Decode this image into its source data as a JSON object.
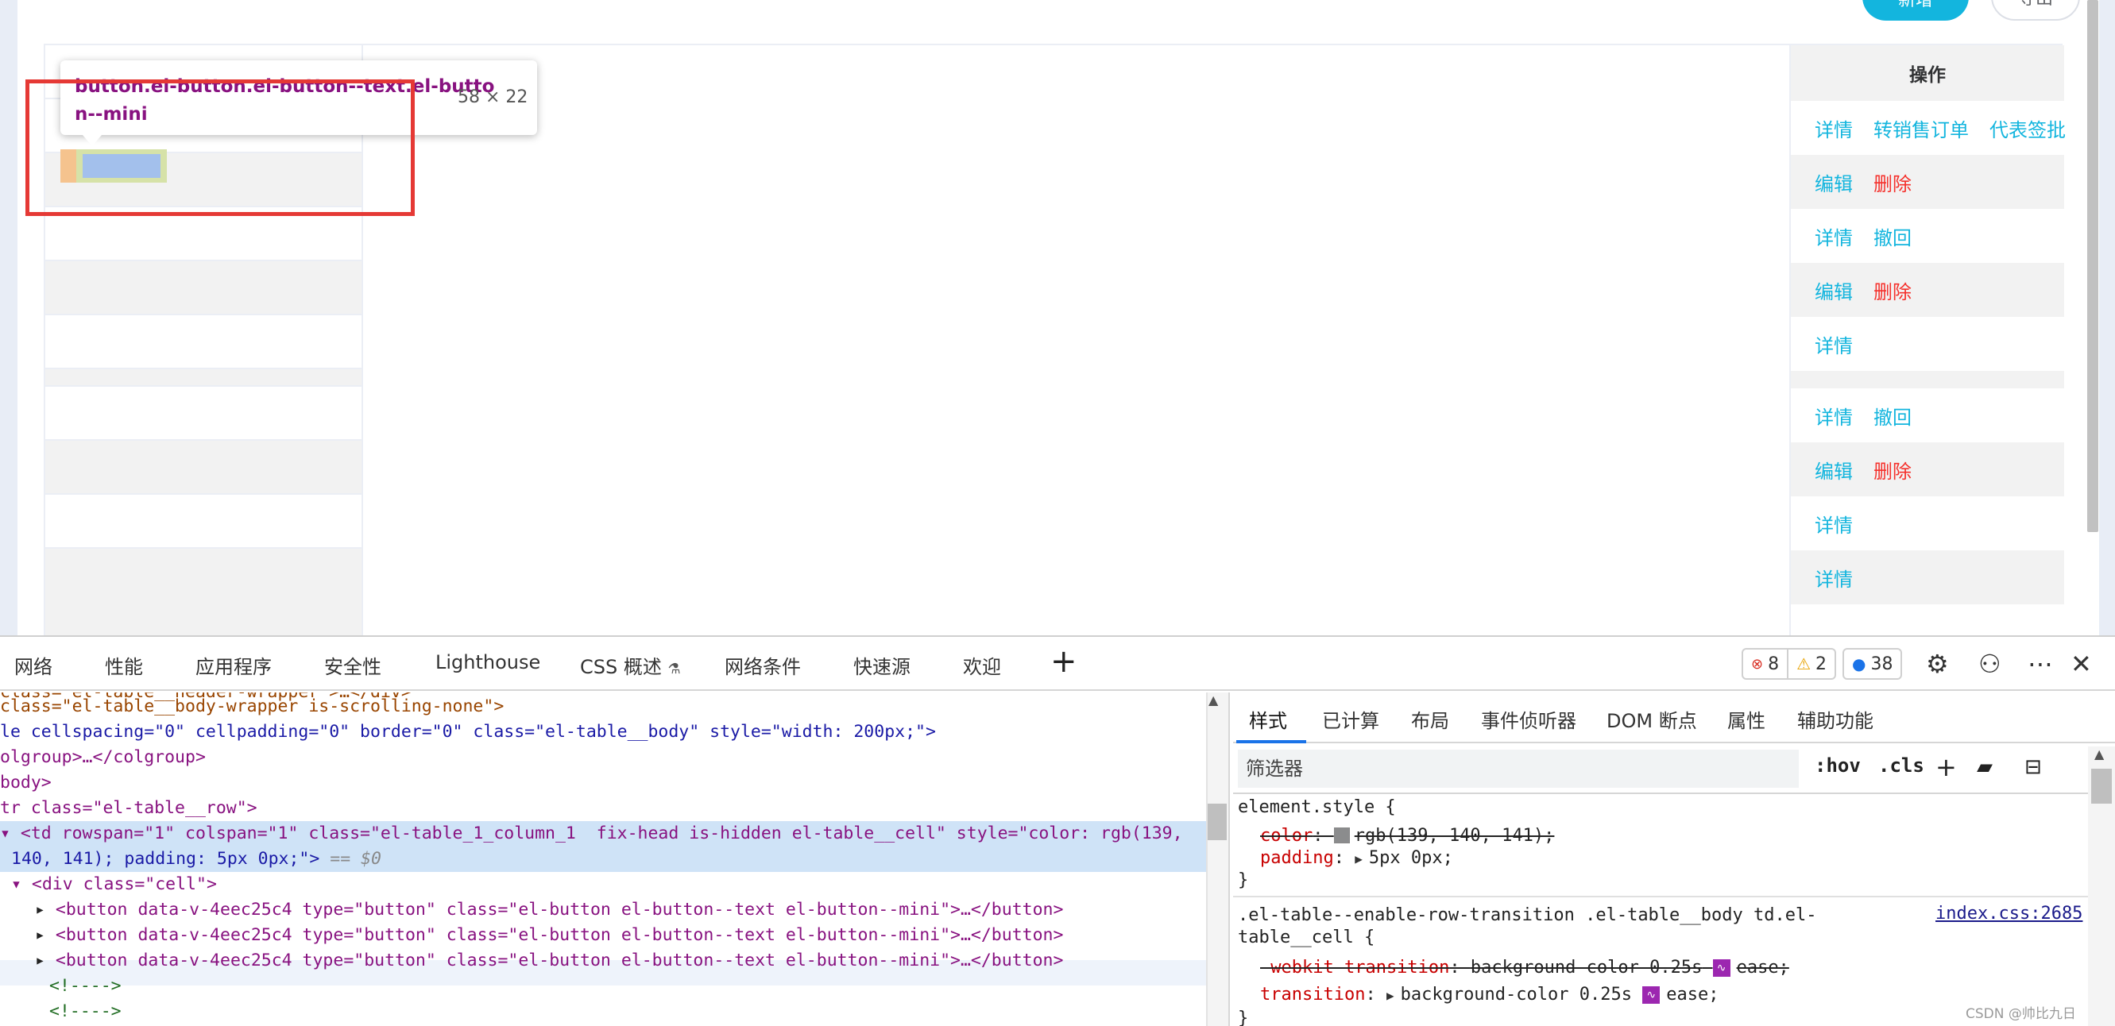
{
  "toolbar": {
    "add_label": "新增",
    "export_label": "导出"
  },
  "table": {
    "ops_header": "操作",
    "rows": [
      {
        "links": [
          "详情",
          "转销售订单",
          "代表签批"
        ],
        "delete": ""
      },
      {
        "links": [
          "编辑"
        ],
        "delete": "删除"
      },
      {
        "links": [
          "详情",
          "撤回"
        ],
        "delete": ""
      },
      {
        "links": [
          "编辑"
        ],
        "delete": "删除"
      },
      {
        "links": [
          "详情"
        ],
        "delete": ""
      },
      {
        "links": [
          "详情",
          "撤回"
        ],
        "delete": ""
      },
      {
        "links": [
          "编辑"
        ],
        "delete": "删除"
      },
      {
        "links": [
          "详情"
        ],
        "delete": ""
      },
      {
        "links": [
          "详情"
        ],
        "delete": ""
      }
    ]
  },
  "inspector_tooltip": {
    "selector": "button.el-button.el-button--text.el-button--mini",
    "size": "58 × 22"
  },
  "devtools": {
    "tabs": [
      "网络",
      "性能",
      "应用程序",
      "安全性",
      "Lighthouse",
      "CSS 概述",
      "网络条件",
      "快速源",
      "欢迎"
    ],
    "errors": "8",
    "warnings": "2",
    "messages": "38",
    "elements": {
      "line1": "class=\"el-table__header-wrapper\">…</div>",
      "line2": "class=\"el-table__body-wrapper is-scrolling-none\">",
      "line3": "le cellspacing=\"0\" cellpadding=\"0\" border=\"0\" class=\"el-table__body\" style=\"width: 200px;\">",
      "line4": "olgroup>…</colgroup>",
      "line5": "body>",
      "line6": "tr class=\"el-table__row\">",
      "line7": "<td rowspan=\"1\" colspan=\"1\" class=\"el-table_1_column_1  fix-head is-hidden el-table__cell\" style=\"color: rgb(139,",
      "line8": "140, 141); padding: 5px 0px;\">",
      "line8_ref": "== $0",
      "line9": "<div class=\"cell\">",
      "button_line": "<button data-v-4eec25c4 type=\"button\" class=\"el-button el-button--text el-button--mini\">…</button>",
      "comment1": "<!---->",
      "comment2": "<!---->"
    },
    "style_tabs": [
      "样式",
      "已计算",
      "布局",
      "事件侦听器",
      "DOM 断点",
      "属性",
      "辅助功能"
    ],
    "filter_placeholder": "筛选器",
    "hov": ":hov",
    "cls": ".cls",
    "rules": {
      "element_style": "element.style {",
      "color_prop": "color",
      "color_val": "rgb(139, 140, 141);",
      "padding_prop": "padding",
      "padding_val": "5px 0px;",
      "close": "}",
      "selector2": ".el-table--enable-row-transition .el-table__body td.el-",
      "selector2b": "table__cell {",
      "source": "index.css:2685",
      "webkit_prop": "-webkit-transition",
      "webkit_val": "background-color 0.25s",
      "ease": "ease;",
      "transition_prop": "transition",
      "transition_val": "background-color 0.25s"
    }
  },
  "watermark": "CSDN @帅比九日"
}
